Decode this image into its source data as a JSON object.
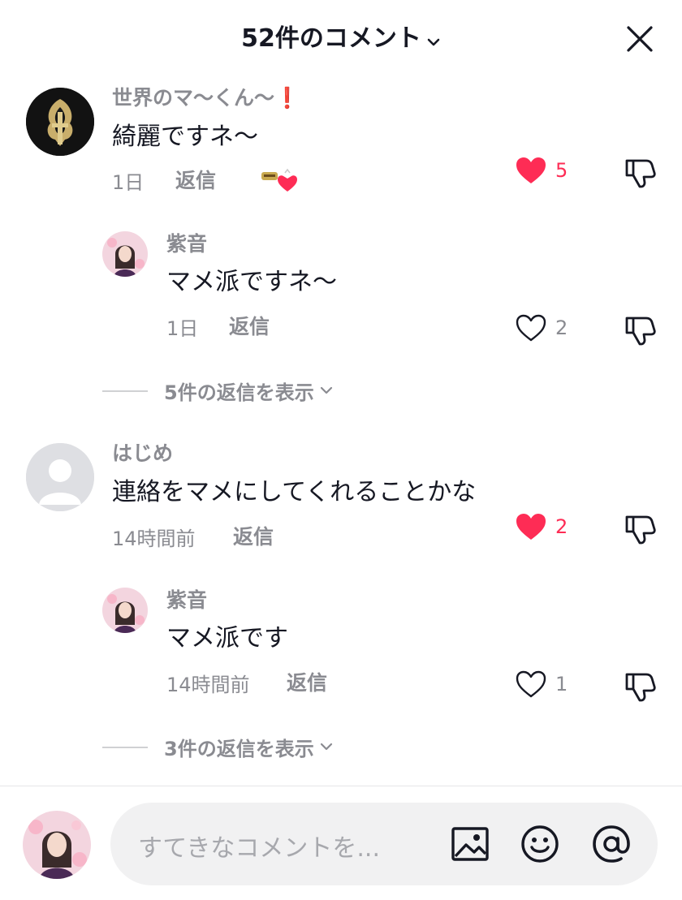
{
  "header": {
    "title": "52件のコメント"
  },
  "comments": [
    {
      "username": "世界のマ〜くん〜",
      "badge": "❗",
      "text": "綺麗ですネ〜",
      "time": "1日",
      "reply_label": "返信",
      "like_count": "5",
      "liked": true,
      "replies": [
        {
          "username": "紫音",
          "text": "マメ派ですネ〜",
          "time": "1日",
          "reply_label": "返信",
          "like_count": "2",
          "liked": false
        }
      ],
      "view_replies": "5件の返信を表示"
    },
    {
      "username": "はじめ",
      "text": "連絡をマメにしてくれることかな",
      "time": "14時間前",
      "reply_label": "返信",
      "like_count": "2",
      "liked": true,
      "replies": [
        {
          "username": "紫音",
          "text": "マメ派です",
          "time": "14時間前",
          "reply_label": "返信",
          "like_count": "1",
          "liked": false
        }
      ],
      "view_replies": "3件の返信を表示"
    }
  ],
  "composer": {
    "placeholder": "すてきなコメントを..."
  },
  "colors": {
    "like_active": "#fe2c55",
    "secondary_text": "#8a8b91",
    "primary_text": "#161823",
    "input_bg": "#f1f1f2"
  },
  "icons": [
    "chevron-down-icon",
    "close-icon",
    "heart-icon",
    "dislike-icon",
    "image-icon",
    "emoji-icon",
    "mention-icon"
  ]
}
